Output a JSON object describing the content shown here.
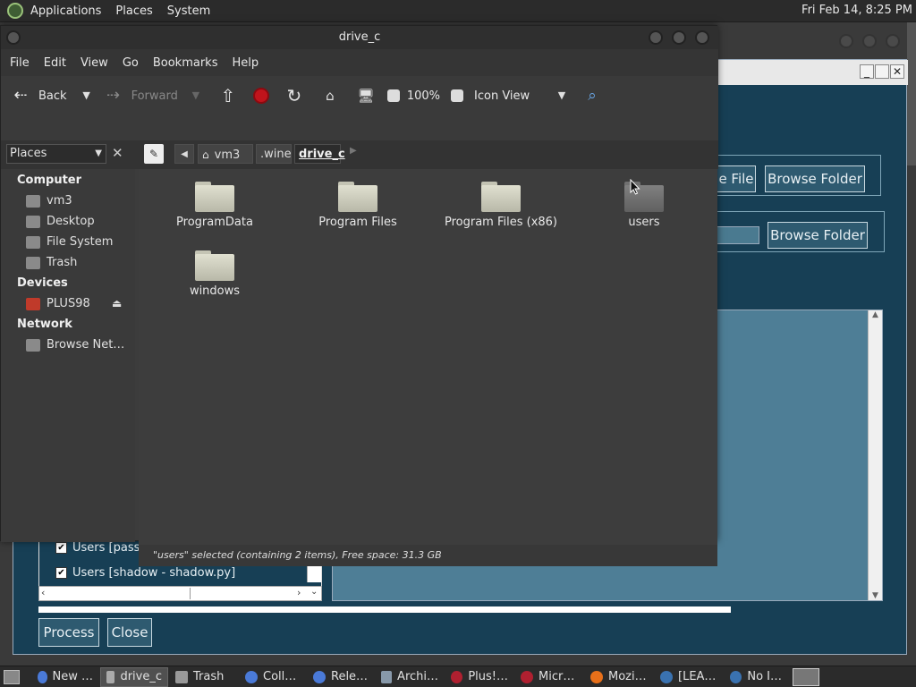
{
  "top_panel": {
    "applications": "Applications",
    "places": "Places",
    "system": "System",
    "clock": "Fri Feb 14,  8:25 PM"
  },
  "bg_app": {
    "browse_file_partial": "e File",
    "browse_folder_1": "Browse Folder",
    "browse_folder_2": "Browse Folder",
    "check_items": [
      "Users [passwd - passwd.py]",
      "Users [shadow - shadow.py]"
    ],
    "process_label": "Process",
    "close_label": "Close",
    "win_minimize": "_",
    "win_close": "✕"
  },
  "file_manager": {
    "title": "drive_c",
    "menu": [
      "File",
      "Edit",
      "View",
      "Go",
      "Bookmarks",
      "Help"
    ],
    "toolbar": {
      "back": "Back",
      "forward": "Forward",
      "zoom": "100%",
      "view_mode": "Icon View"
    },
    "places_combo": "Places",
    "breadcrumbs": [
      "vm3",
      ".wine",
      "drive_c"
    ],
    "sidebar": {
      "computer_heading": "Computer",
      "computer_items": [
        "vm3",
        "Desktop",
        "File System",
        "Trash"
      ],
      "devices_heading": "Devices",
      "device_items": [
        "PLUS98"
      ],
      "network_heading": "Network",
      "network_items": [
        "Browse Net…"
      ]
    },
    "folders": [
      "ProgramData",
      "Program Files",
      "Program Files (x86)",
      "users",
      "windows"
    ],
    "status": "\"users\" selected (containing 2 items), Free space: 31.3 GB"
  },
  "taskbar": {
    "items": [
      "New …",
      "drive_c",
      "Trash",
      "Coll…",
      "Rele…",
      "Archi…",
      "Plus!…",
      "Micr…",
      "Mozi…",
      "[LEA…",
      "No I…"
    ]
  },
  "colors": {
    "bg_app_blue": "#173f55",
    "panel": "#2b2b2b",
    "window": "#3c3c3c",
    "stop_red": "#c0141c"
  }
}
